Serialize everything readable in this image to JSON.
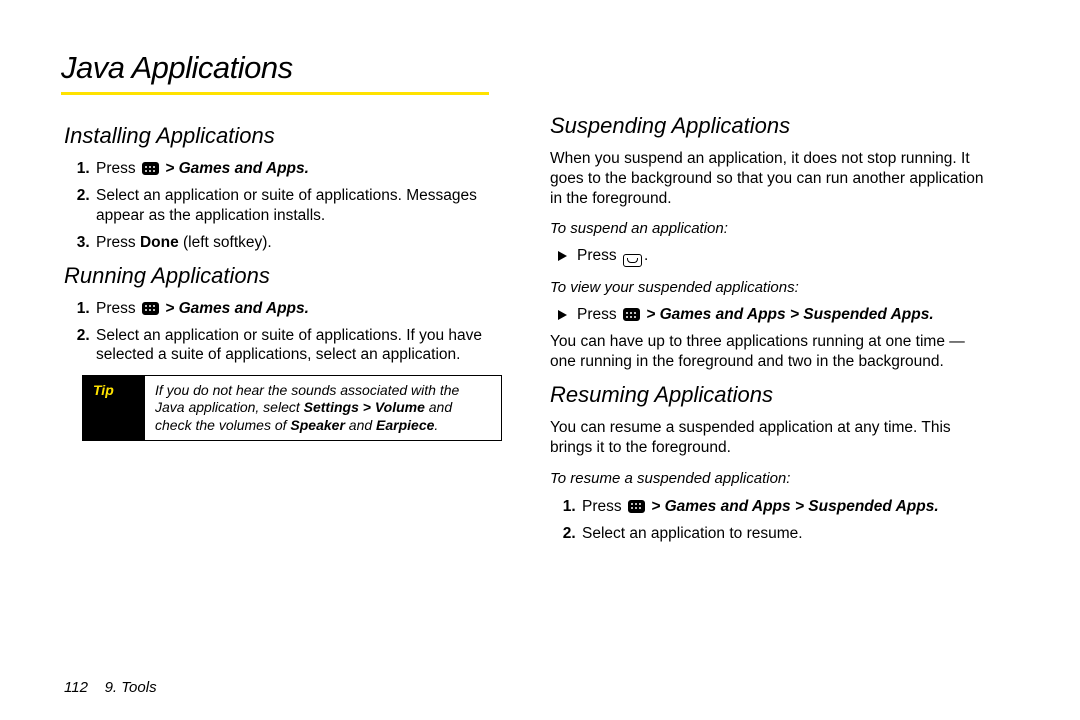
{
  "title": "Java Applications",
  "footer": {
    "page": "112",
    "section": "9. Tools"
  },
  "left": {
    "installing": {
      "heading": "Installing Applications",
      "steps": [
        {
          "pre": "Press ",
          "path": " > Games and Apps."
        },
        {
          "text": "Select an application or suite of applications. Messages appear as the application installs."
        },
        {
          "parts": [
            "Press ",
            "Done",
            " (left softkey)."
          ]
        }
      ]
    },
    "running": {
      "heading": "Running Applications",
      "steps": [
        {
          "pre": "Press ",
          "path": " > Games and Apps."
        },
        {
          "text": "Select an application or suite of applications. If you have selected a suite of applications, select an application."
        }
      ]
    },
    "tip": {
      "label": "Tip",
      "body_parts": [
        "If you do not hear the sounds associated with the Java application, select ",
        "Settings > Volume",
        " and check the volumes of ",
        "Speaker",
        " and ",
        "Earpiece",
        "."
      ]
    }
  },
  "right": {
    "suspending": {
      "heading": "Suspending Applications",
      "intro": "When you suspend an application, it does not stop running. It goes to the background so that you can run another application in the foreground.",
      "sub1": "To suspend an application:",
      "b1_pre": "Press ",
      "b1_post": ".",
      "sub2": "To view your suspended applications:",
      "b2_pre": "Press ",
      "b2_path": " > Games and Apps > Suspended Apps.",
      "outro": "You can have up to three applications running at one time — one running in the foreground and two in the background."
    },
    "resuming": {
      "heading": "Resuming Applications",
      "intro": "You can resume a suspended application at any time. This brings it to the foreground.",
      "sub": "To resume a suspended application:",
      "steps": [
        {
          "pre": "Press ",
          "path": " > Games and Apps > Suspended Apps."
        },
        {
          "text": "Select an application to resume."
        }
      ]
    }
  }
}
